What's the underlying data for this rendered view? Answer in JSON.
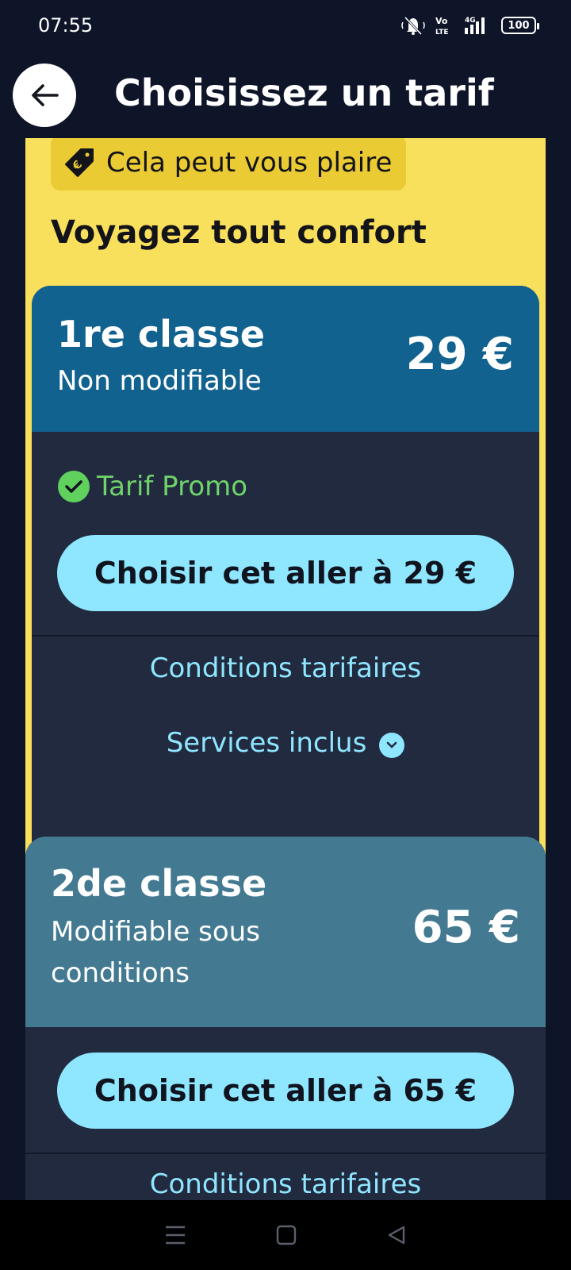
{
  "status_bar": {
    "time": "07:55",
    "icons": [
      "mute-icon",
      "volte-icon",
      "signal-4g-icon"
    ],
    "volte_label": "Vo\nLTE",
    "network": "4G",
    "battery": "100"
  },
  "header": {
    "back_icon": "arrow-left-icon",
    "title": "Choisissez un tarif"
  },
  "highlight": {
    "tag_icon": "euro-tag-icon",
    "tag_label": "Cela peut vous plaire",
    "title": "Voyagez tout confort"
  },
  "fares": [
    {
      "class_name": "1re classe",
      "condition": "Non modifiable",
      "price": "29 €",
      "promo_icon": "check-circle-icon",
      "promo_label": "Tarif Promo",
      "button_label": "Choisir cet aller à 29 €",
      "conditions_link": "Conditions tarifaires",
      "services_link": "Services inclus",
      "services_icon": "chevron-down-icon"
    },
    {
      "class_name": "2de classe",
      "condition": "Modifiable sous conditions",
      "price": "65 €",
      "button_label": "Choisir cet aller à 65 €",
      "conditions_link": "Conditions tarifaires"
    }
  ],
  "colors": {
    "background": "#0e1529",
    "highlight_yellow": "#f8df5c",
    "first_class_header": "#12628f",
    "second_class_header": "#437a91",
    "card_body": "#222a3f",
    "button": "#8fe6ff",
    "promo_green": "#6fd36a"
  },
  "nav_bar": {
    "icons": [
      "menu-icon",
      "home-square-icon",
      "back-triangle-icon"
    ]
  }
}
